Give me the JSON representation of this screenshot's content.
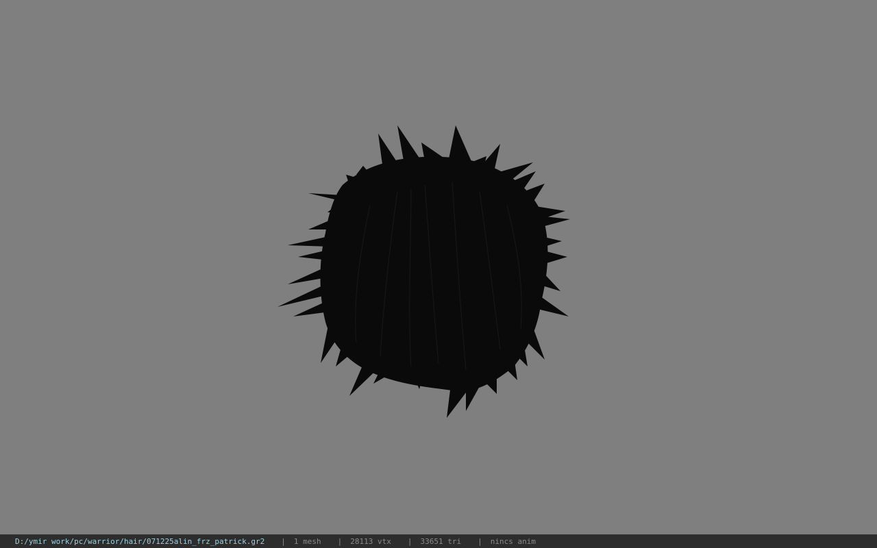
{
  "viewer": {
    "background_color": "#7f7f7f",
    "model_color": "#0a0a0a",
    "model_name": "hair-model"
  },
  "status_bar": {
    "file_path": "D:/ymir work/pc/warrior/hair/071225alin_frz_patrick.gr2",
    "separator": "|",
    "mesh_count": "1 mesh",
    "vertex_count": "28113 vtx",
    "triangle_count": "33651 tri",
    "anim_status": "nincs anim"
  }
}
